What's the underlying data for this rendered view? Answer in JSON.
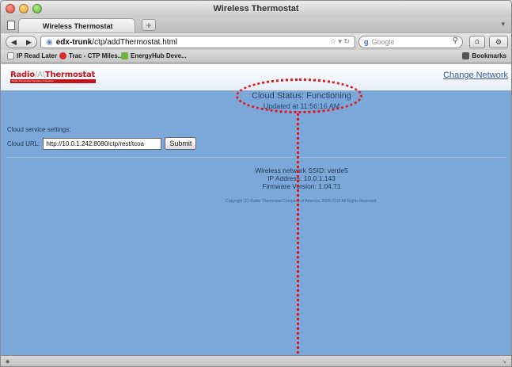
{
  "window": {
    "title": "Wireless Thermostat"
  },
  "tabs": [
    {
      "label": "Wireless Thermostat"
    }
  ],
  "newtab_label": "+",
  "navbar": {
    "url_domain": "edx-trunk",
    "url_path": "/ctp/addThermostat.html",
    "search_placeholder": "Google",
    "search_engine_icon": "google-icon"
  },
  "bookmarks": {
    "items": [
      {
        "label": "IP Read Later"
      },
      {
        "label": "Trac - CTP Miles..."
      },
      {
        "label": "EnergyHub Deve..."
      }
    ],
    "bookmarks_label": "Bookmarks"
  },
  "header": {
    "logo_part1": "Radio",
    "logo_part2": "Thermostat",
    "logo_tagline": "Radio Thermostat Company of America",
    "change_network": "Change Network"
  },
  "cloud": {
    "status": "Cloud Status: Functioning",
    "updated": "Updated at 11:56:16 AM"
  },
  "settings": {
    "heading": "Cloud service settings:",
    "url_label": "Cloud URL:",
    "url_value": "http://10.0.1.242:8080/ctp/rest/tcoa",
    "submit_label": "Submit"
  },
  "network": {
    "ssid": "Wireless network SSID: verde5",
    "ip": "IP Address: 10.0.1.143",
    "firmware": "Firmware Version: 1.04.71"
  },
  "copyright": "Copyright (C) Radio Thermostat Company of America, 2009-2010 All Rights Reserved.",
  "colors": {
    "page_bg": "#7ba8d8",
    "annotation": "#e4141a",
    "logo_red": "#c0141a"
  }
}
